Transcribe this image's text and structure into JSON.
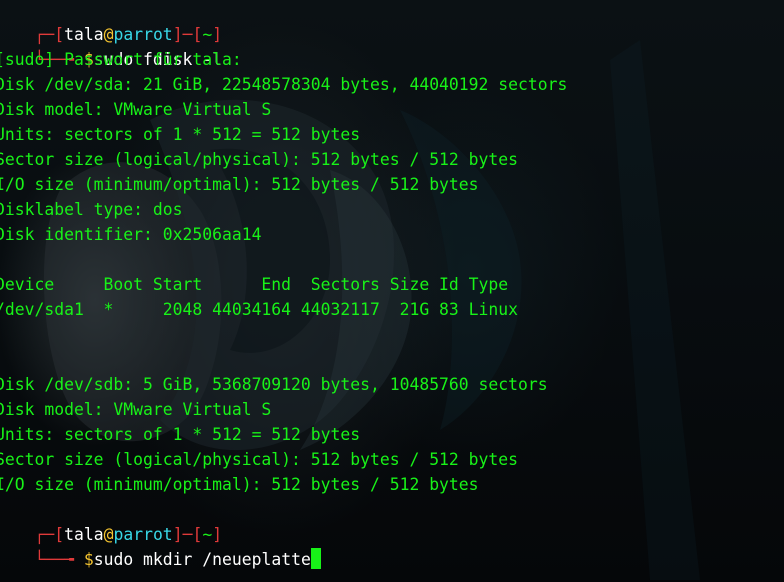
{
  "prompt": {
    "user": "tala",
    "at": "@",
    "host": "parrot",
    "dir": "~",
    "open_bracket": "[",
    "close_bracket": "]",
    "dash": "─",
    "arrow": "╼",
    "top_corner": "┌",
    "bottom_corner": "└──",
    "symbol": "$"
  },
  "lines": {
    "l2_cmd": "sudo fdisk -l",
    "l3": "[sudo] Passwort für tala:",
    "l4": "Disk /dev/sda: 21 GiB, 22548578304 bytes, 44040192 sectors",
    "l5": "Disk model: VMware Virtual S",
    "l6": "Units: sectors of 1 * 512 = 512 bytes",
    "l7": "Sector size (logical/physical): 512 bytes / 512 bytes",
    "l8": "I/O size (minimum/optimal): 512 bytes / 512 bytes",
    "l9": "Disklabel type: dos",
    "l10": "Disk identifier: 0x2506aa14",
    "l12": "Device     Boot Start      End  Sectors Size Id Type",
    "l13": "/dev/sda1  *     2048 44034164 44032117  21G 83 Linux",
    "l16": "Disk /dev/sdb: 5 GiB, 5368709120 bytes, 10485760 sectors",
    "l17": "Disk model: VMware Virtual S",
    "l18": "Units: sectors of 1 * 512 = 512 bytes",
    "l19": "Sector size (logical/physical): 512 bytes / 512 bytes",
    "l20": "I/O size (minimum/optimal): 512 bytes / 512 bytes",
    "l22_cmd": "sudo mkdir /neueplatte"
  },
  "colors": {
    "output_green": "#18f218",
    "prompt_red": "#e03a3a",
    "host_cyan": "#38d7e6",
    "at_yellow": "#f4c430",
    "background": "#05080a"
  },
  "icons": {
    "cursor": "block-cursor-icon"
  }
}
